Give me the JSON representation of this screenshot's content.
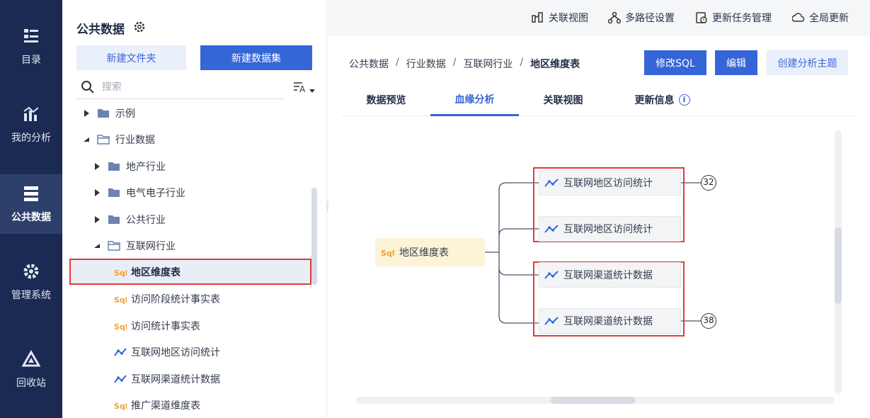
{
  "nav": {
    "items": [
      {
        "label": "目录",
        "icon": "catalog-icon"
      },
      {
        "label": "我的分析",
        "icon": "analysis-icon"
      },
      {
        "label": "公共数据",
        "icon": "public-data-icon",
        "active": true
      },
      {
        "label": "管理系统",
        "icon": "gear-admin-icon"
      },
      {
        "label": "回收站",
        "icon": "recycle-icon"
      }
    ]
  },
  "panel": {
    "title": "公共数据",
    "new_folder": "新建文件夹",
    "new_dataset": "新建数据集",
    "search_placeholder": "搜索",
    "tree": [
      {
        "label": "示例",
        "type": "folder",
        "level": 0,
        "expanded": false
      },
      {
        "label": "行业数据",
        "type": "folder",
        "level": 0,
        "expanded": true
      },
      {
        "label": "地产行业",
        "type": "folder",
        "level": 1,
        "expanded": false
      },
      {
        "label": "电气电子行业",
        "type": "folder",
        "level": 1,
        "expanded": false
      },
      {
        "label": "公共行业",
        "type": "folder",
        "level": 1,
        "expanded": false
      },
      {
        "label": "互联网行业",
        "type": "folder",
        "level": 1,
        "expanded": true
      },
      {
        "label": "地区维度表",
        "type": "sql",
        "level": 2,
        "selected": true
      },
      {
        "label": "访问阶段统计事实表",
        "type": "sql",
        "level": 2
      },
      {
        "label": "访问统计事实表",
        "type": "sql",
        "level": 2
      },
      {
        "label": "互联网地区访问统计",
        "type": "analysis",
        "level": 2
      },
      {
        "label": "互联网渠道统计数据",
        "type": "analysis",
        "level": 2
      },
      {
        "label": "推广渠道维度表",
        "type": "sql",
        "level": 2
      }
    ]
  },
  "topbar": {
    "related_view": "关联视图",
    "multipath": "多路径设置",
    "update_tasks": "更新任务管理",
    "global_update": "全局更新"
  },
  "breadcrumb": [
    "公共数据",
    "行业数据",
    "互联网行业",
    "地区维度表"
  ],
  "actions": {
    "edit_sql": "修改SQL",
    "edit": "编辑",
    "create_topic": "创建分析主题"
  },
  "tabs": [
    {
      "label": "数据预览"
    },
    {
      "label": "血缘分析",
      "active": true
    },
    {
      "label": "关联视图"
    },
    {
      "label": "更新信息"
    }
  ],
  "lineage": {
    "root": "地区维度表",
    "children": [
      {
        "label": "互联网地区访问统计",
        "count": "32"
      },
      {
        "label": "互联网地区访问统计",
        "count": ""
      },
      {
        "label": "互联网渠道统计数据",
        "count": ""
      },
      {
        "label": "互联网渠道统计数据",
        "count": "38"
      }
    ]
  },
  "colors": {
    "nav_bg": "#1a2a52",
    "primary": "#3566d8",
    "highlight_border": "#e03b3b",
    "root_bg": "#fdf3d6",
    "sql_icon": "#f0a030"
  }
}
